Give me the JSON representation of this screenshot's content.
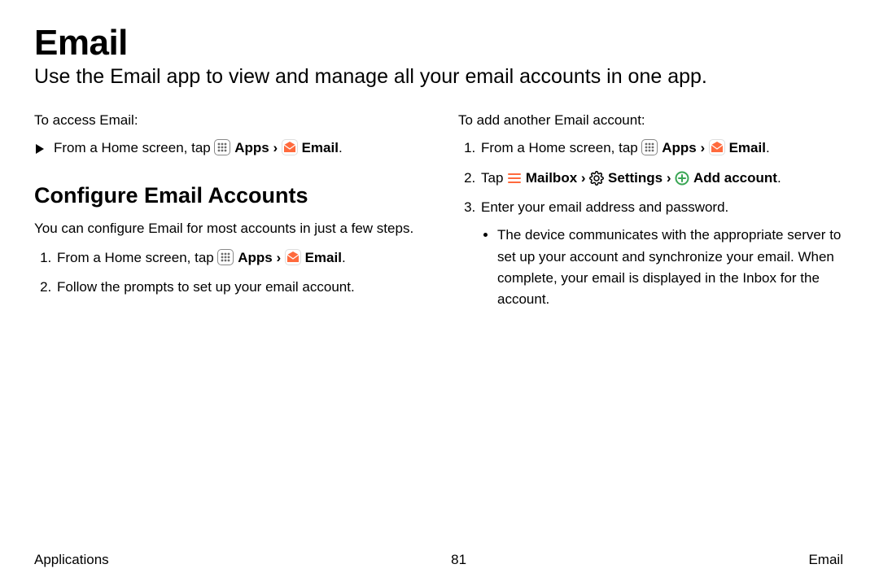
{
  "title": "Email",
  "subtitle": "Use the Email app to view and manage all your email accounts in one app.",
  "left": {
    "access_intro": "To access Email:",
    "access_step_prefix": "From a Home screen, tap ",
    "apps_label": "Apps",
    "email_label": "Email",
    "configure_heading": "Configure Email Accounts",
    "configure_para": "You can configure Email for most accounts in just a few steps.",
    "step1_prefix": "From a Home screen, tap ",
    "step2": "Follow the prompts to set up your email account."
  },
  "right": {
    "add_intro": "To add another Email account:",
    "step1_prefix": "From a Home screen, tap ",
    "apps_label": "Apps",
    "email_label": "Email",
    "step2_prefix": "Tap ",
    "mailbox_label": "Mailbox",
    "settings_label": "Settings",
    "add_account_label": "Add account",
    "step3": "Enter your email address and password.",
    "step3_bullet": "The device communicates with the appropriate server to set up your account and synchronize your email. When complete, your email is displayed in the Inbox for the account."
  },
  "footer": {
    "left": "Applications",
    "center": "81",
    "right": "Email"
  },
  "glyphs": {
    "chevron": "›",
    "period": "."
  }
}
